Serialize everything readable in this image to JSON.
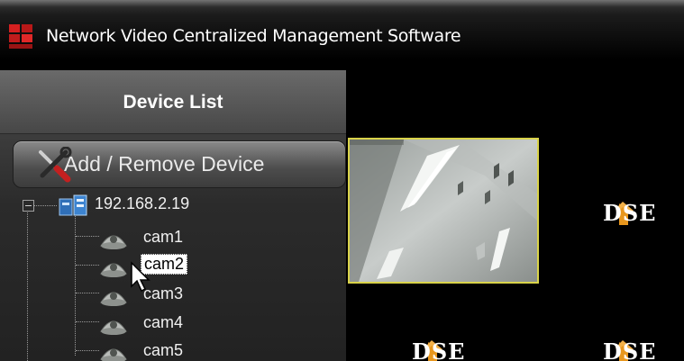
{
  "window": {
    "title": "Network Video Centralized Management Software"
  },
  "panel": {
    "title": "Device List",
    "add_remove_label": "Add / Remove Device"
  },
  "tree": {
    "device_ip": "192.168.2.19",
    "cameras": [
      {
        "label": "cam1",
        "selected": false
      },
      {
        "label": "cam2",
        "selected": true
      },
      {
        "label": "cam3",
        "selected": false
      },
      {
        "label": "cam4",
        "selected": false
      },
      {
        "label": "cam5",
        "selected": false
      }
    ]
  },
  "video": {
    "cell1_overlay": "",
    "logo_text": "DSE"
  },
  "colors": {
    "selection_border": "#d9d34a",
    "logo_accent": "#e8971e",
    "brand_red": "#d42020"
  }
}
